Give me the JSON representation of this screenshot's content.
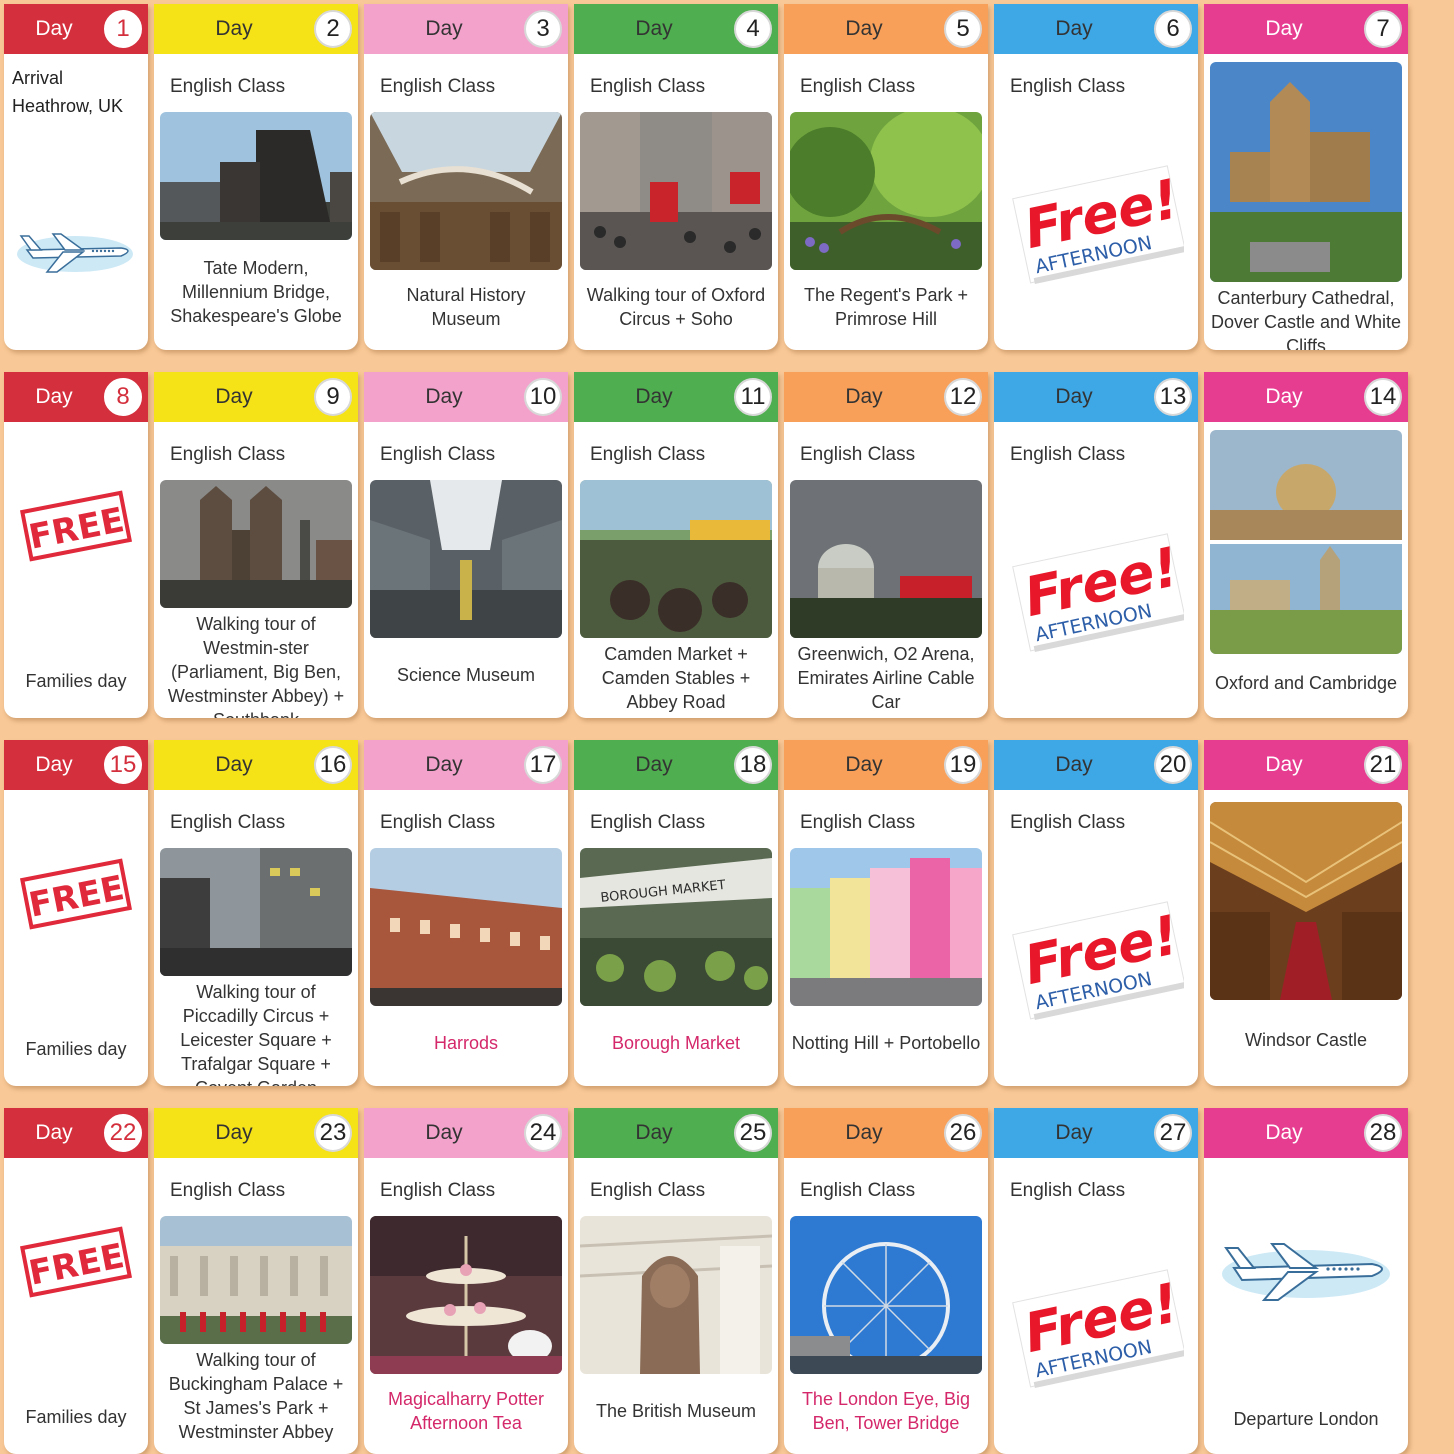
{
  "day_label": "Day",
  "english_class": "English Class",
  "days": [
    {
      "num": "1",
      "top": "Arrival Heathrow, UK"
    },
    {
      "num": "2",
      "caption": "Tate Modern, Millennium Bridge, Shakespeare's Globe"
    },
    {
      "num": "3",
      "caption": "Natural History Museum"
    },
    {
      "num": "4",
      "caption": "Walking tour of Oxford Circus + Soho"
    },
    {
      "num": "5",
      "caption": "The Regent's Park + Primrose Hill"
    },
    {
      "num": "6",
      "free": "Free!",
      "afternoon": "AFTERNOON"
    },
    {
      "num": "7",
      "caption": "Canterbury Cathedral, Dover Castle and White Cliffs"
    },
    {
      "num": "8",
      "stamp": "FREE",
      "bottom": "Families day"
    },
    {
      "num": "9",
      "caption": "Walking tour of Westmin-ster (Parliament, Big Ben, Westminster Abbey) + Southbank"
    },
    {
      "num": "10",
      "caption": "Science Museum"
    },
    {
      "num": "11",
      "caption": "Camden Market + Camden Stables + Abbey Road"
    },
    {
      "num": "12",
      "caption": "Greenwich, O2 Arena, Emirates Airline Cable Car"
    },
    {
      "num": "13",
      "free": "Free!",
      "afternoon": "AFTERNOON"
    },
    {
      "num": "14",
      "caption": "Oxford and Cambridge"
    },
    {
      "num": "15",
      "stamp": "FREE",
      "bottom": "Families day"
    },
    {
      "num": "16",
      "caption": "Walking tour of Piccadilly Circus + Leicester Square + Trafalgar Square + Covent Garden"
    },
    {
      "num": "17",
      "caption": "Harrods"
    },
    {
      "num": "18",
      "caption": "Borough Market",
      "photo_sign": "BOROUGH MARKET"
    },
    {
      "num": "19",
      "caption": "Notting Hill + Portobello"
    },
    {
      "num": "20",
      "free": "Free!",
      "afternoon": "AFTERNOON"
    },
    {
      "num": "21",
      "caption": "Windsor Castle"
    },
    {
      "num": "22",
      "stamp": "FREE",
      "bottom": "Families day"
    },
    {
      "num": "23",
      "caption": "Walking tour of Buckingham Palace + St James's Park + Westminster Abbey"
    },
    {
      "num": "24",
      "caption": "Magicalharry Potter Afternoon Tea"
    },
    {
      "num": "25",
      "caption": "The British Museum"
    },
    {
      "num": "26",
      "caption": "The London Eye, Big Ben, Tower Bridge"
    },
    {
      "num": "27",
      "free": "Free!",
      "afternoon": "AFTERNOON"
    },
    {
      "num": "28",
      "bottom": "Departure London"
    }
  ],
  "colors": {
    "background": "#f8c896",
    "red": "#d32f3c",
    "yellow": "#f5e217",
    "pink": "#f3a2cc",
    "green": "#4fae4f",
    "orange": "#f8a05a",
    "blue": "#3ea7e6",
    "magenta": "#e63d91",
    "highlight_caption": "#d4286a"
  },
  "icons": {
    "airplane": "airplane-icon",
    "free_stamp": "free-stamp-icon",
    "free_afternoon": "free-afternoon-badge"
  }
}
